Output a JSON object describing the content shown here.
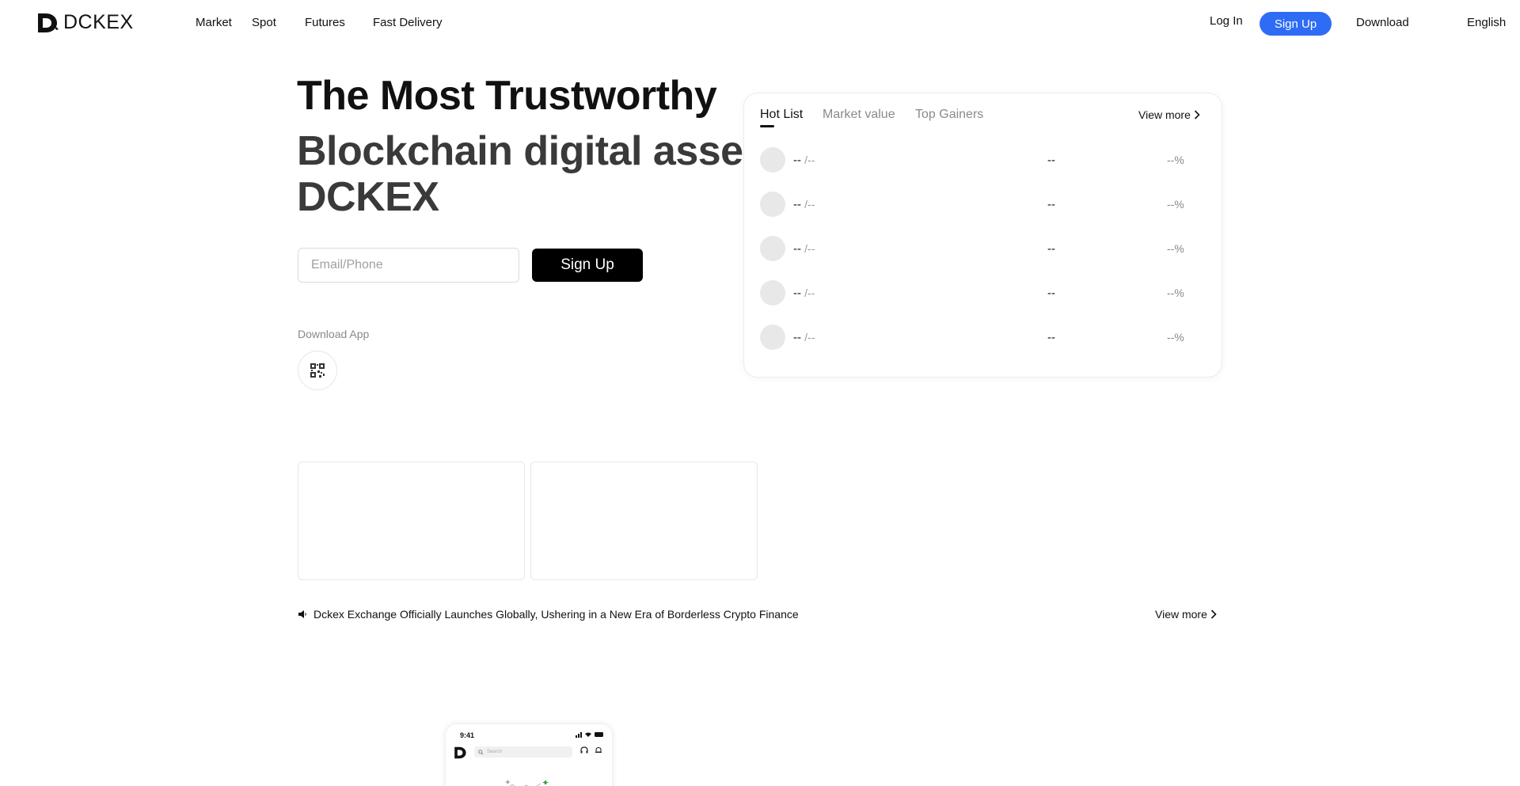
{
  "header": {
    "brand": "DCKEX",
    "nav": [
      {
        "label": "Market"
      },
      {
        "label": "Spot"
      },
      {
        "label": "Futures"
      },
      {
        "label": "Fast Delivery"
      }
    ],
    "login_label": "Log In",
    "signup_label": "Sign Up",
    "download_label": "Download",
    "language_label": "English"
  },
  "hero": {
    "title_line1": "The Most Trustworthy",
    "title_line2": "Blockchain digital asset",
    "title_line3": "DCKEX",
    "email_placeholder": "Email/Phone",
    "signup_label": "Sign Up",
    "download_app_label": "Download App"
  },
  "market": {
    "tabs": [
      {
        "label": "Hot List",
        "active": true
      },
      {
        "label": "Market value",
        "active": false
      },
      {
        "label": "Top Gainers",
        "active": false
      }
    ],
    "view_more": "View more",
    "rows": [
      {
        "base": "--",
        "quote": "/--",
        "price": "--",
        "change": "--%"
      },
      {
        "base": "--",
        "quote": "/--",
        "price": "--",
        "change": "--%"
      },
      {
        "base": "--",
        "quote": "/--",
        "price": "--",
        "change": "--%"
      },
      {
        "base": "--",
        "quote": "/--",
        "price": "--",
        "change": "--%"
      },
      {
        "base": "--",
        "quote": "/--",
        "price": "--",
        "change": "--%"
      }
    ]
  },
  "announcement": {
    "text": "Dckex Exchange Officially Launches Globally, Ushering in a New Era of Borderless Crypto Finance",
    "view_more": "View more"
  },
  "phone": {
    "time": "9:41",
    "search_placeholder": "Search",
    "brand_small": "DCKEX"
  },
  "colors": {
    "accent": "#2e6cf6",
    "primary_button": "#000000"
  }
}
